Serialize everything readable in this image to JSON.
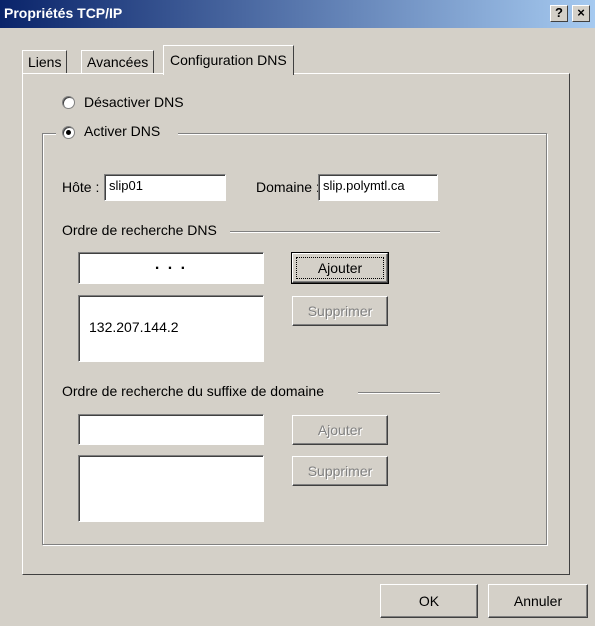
{
  "window": {
    "title": "Propriétés TCP/IP",
    "help_button": "?",
    "close_button": "×"
  },
  "tabs": [
    {
      "label": "Liens"
    },
    {
      "label": "Avancées"
    },
    {
      "label": "Configuration DNS",
      "active": true
    }
  ],
  "dns": {
    "disable_label": "Désactiver DNS",
    "enable_label": "Activer DNS",
    "enabled": true,
    "host_label": "Hôte :",
    "host_value": "slip01",
    "domain_label": "Domaine :",
    "domain_value": "slip.polymtl.ca",
    "search_order_label": "Ordre de recherche DNS",
    "ip_input_value": ".       .       .",
    "add_label": "Ajouter",
    "remove_label": "Supprimer",
    "servers": [
      "132.207.144.2"
    ],
    "suffix_order_label": "Ordre de recherche du suffixe de domaine",
    "suffix_add_label": "Ajouter",
    "suffix_remove_label": "Supprimer",
    "suffix_input_value": "",
    "suffixes": []
  },
  "footer": {
    "ok_label": "OK",
    "cancel_label": "Annuler"
  }
}
